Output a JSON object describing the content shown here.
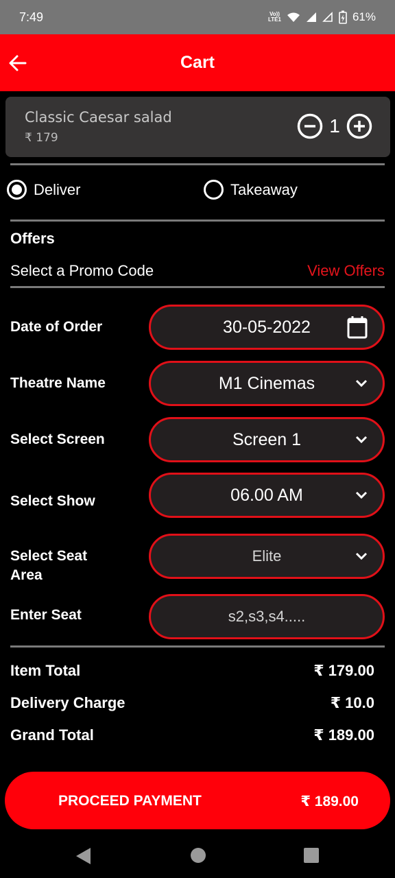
{
  "status_bar": {
    "time": "7:49",
    "network_label_top": "Vo))",
    "network_label_bottom": "LTE1",
    "battery_percent": "61%"
  },
  "app_bar": {
    "title": "Cart",
    "back_icon": "arrow-left-icon"
  },
  "cart_item": {
    "name": "Classic Caesar salad",
    "price": "₹ 179",
    "quantity": "1",
    "decrement_icon": "minus-circle-icon",
    "increment_icon": "plus-circle-icon"
  },
  "delivery_options": {
    "options": [
      {
        "label": "Deliver",
        "selected": true
      },
      {
        "label": "Takeaway",
        "selected": false
      }
    ]
  },
  "offers": {
    "title": "Offers",
    "promo_label": "Select a Promo Code",
    "view_offers_label": "View Offers"
  },
  "form": {
    "date": {
      "label": "Date of Order",
      "value": "30-05-2022",
      "icon": "calendar-icon"
    },
    "theatre": {
      "label": "Theatre Name",
      "value": "M1 Cinemas",
      "icon": "chevron-down-icon"
    },
    "screen": {
      "label": "Select Screen",
      "value": "Screen 1",
      "icon": "chevron-down-icon"
    },
    "show": {
      "label": "Select Show",
      "value": "06.00 AM",
      "icon": "chevron-down-icon"
    },
    "seat_area": {
      "label_line1": "Select Seat",
      "label_line2": "Area",
      "value": "Elite",
      "icon": "chevron-down-icon"
    },
    "seat": {
      "label": "Enter Seat",
      "placeholder": "s2,s3,s4....."
    }
  },
  "summary": {
    "item_total_label": "Item Total",
    "item_total_value": "₹ 179.00",
    "delivery_charge_label": "Delivery Charge",
    "delivery_charge_value": "₹ 10.0",
    "grand_total_label": "Grand Total",
    "grand_total_value": "₹ 189.00"
  },
  "payment_button": {
    "label": "PROCEED PAYMENT",
    "amount": "₹ 189.00"
  },
  "colors": {
    "accent_red": "#ff000a",
    "field_border": "#e01018",
    "link_red": "#e5141c",
    "field_bg": "#231f20",
    "card_bg": "#363434"
  }
}
